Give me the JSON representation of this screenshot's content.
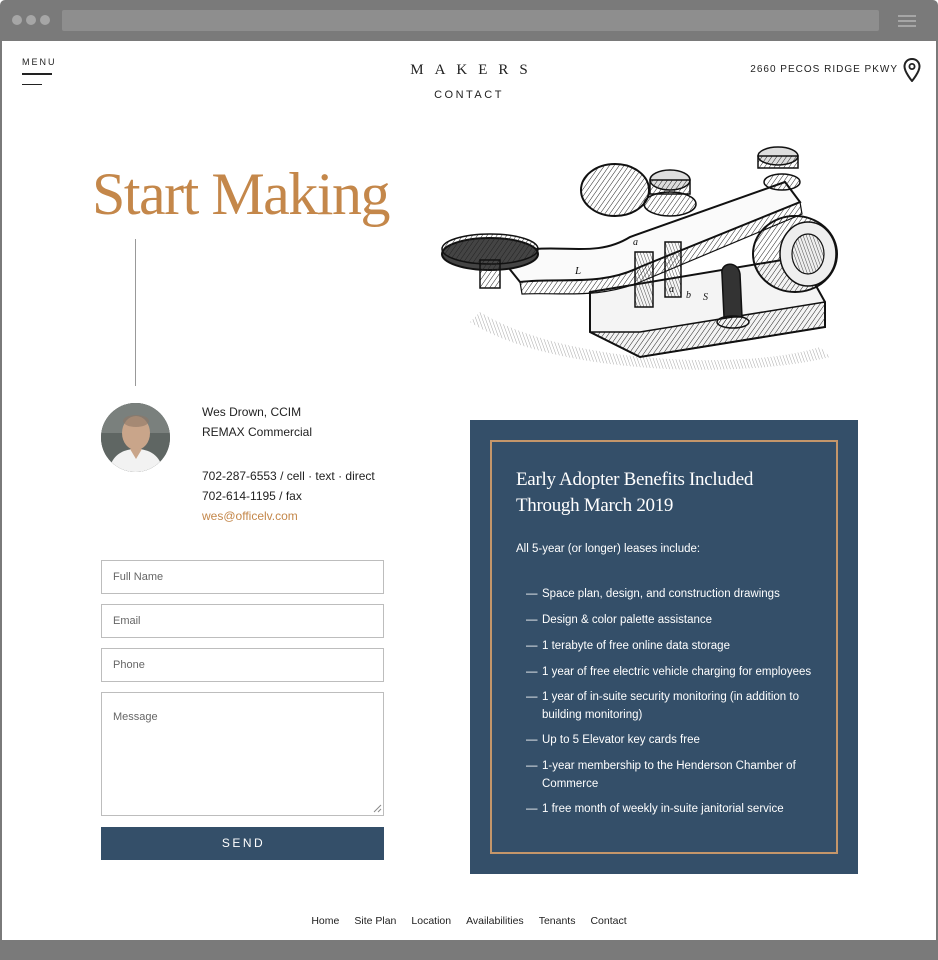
{
  "header": {
    "menu_label": "MENU",
    "logo": "MAKERS",
    "subtitle": "CONTACT",
    "address": "2660 PECOS RIDGE PKWY"
  },
  "hero": {
    "headline": "Start Making"
  },
  "contact": {
    "name": "Wes Drown, CCIM",
    "company": "REMAX Commercial",
    "phone_cell": "702-287-6553 / cell · text · direct",
    "phone_fax": "702-614-1195 / fax",
    "email": "wes@officelv.com"
  },
  "form": {
    "full_name_placeholder": "Full Name",
    "email_placeholder": "Email",
    "phone_placeholder": "Phone",
    "message_placeholder": "Message",
    "send_label": "SEND"
  },
  "benefits": {
    "title_line1": "Early Adopter Benefits Included",
    "title_line2": "Through March 2019",
    "intro": "All 5-year (or longer) leases include:",
    "dash": "—",
    "items": [
      "Space plan, design, and construction drawings",
      "Design & color palette assistance",
      "1 terabyte of free online data storage",
      "1 year of free electric vehicle charging for employees",
      "1 year of in-suite security monitoring (in addition to building monitoring)",
      "Up to 5 Elevator key cards free",
      "1-year membership to the Henderson Chamber of Commerce",
      "1 free month of weekly in-suite janitorial service"
    ]
  },
  "footer": {
    "links": [
      "Home",
      "Site Plan",
      "Location",
      "Availabilities",
      "Tenants",
      "Contact"
    ]
  },
  "colors": {
    "accent": "#c4874a",
    "panel": "#344f69",
    "panel_border": "#c4966a",
    "browser_chrome": "#7a7a7a"
  },
  "icons": {
    "menu": "hamburger-icon",
    "address": "map-pin-icon"
  }
}
